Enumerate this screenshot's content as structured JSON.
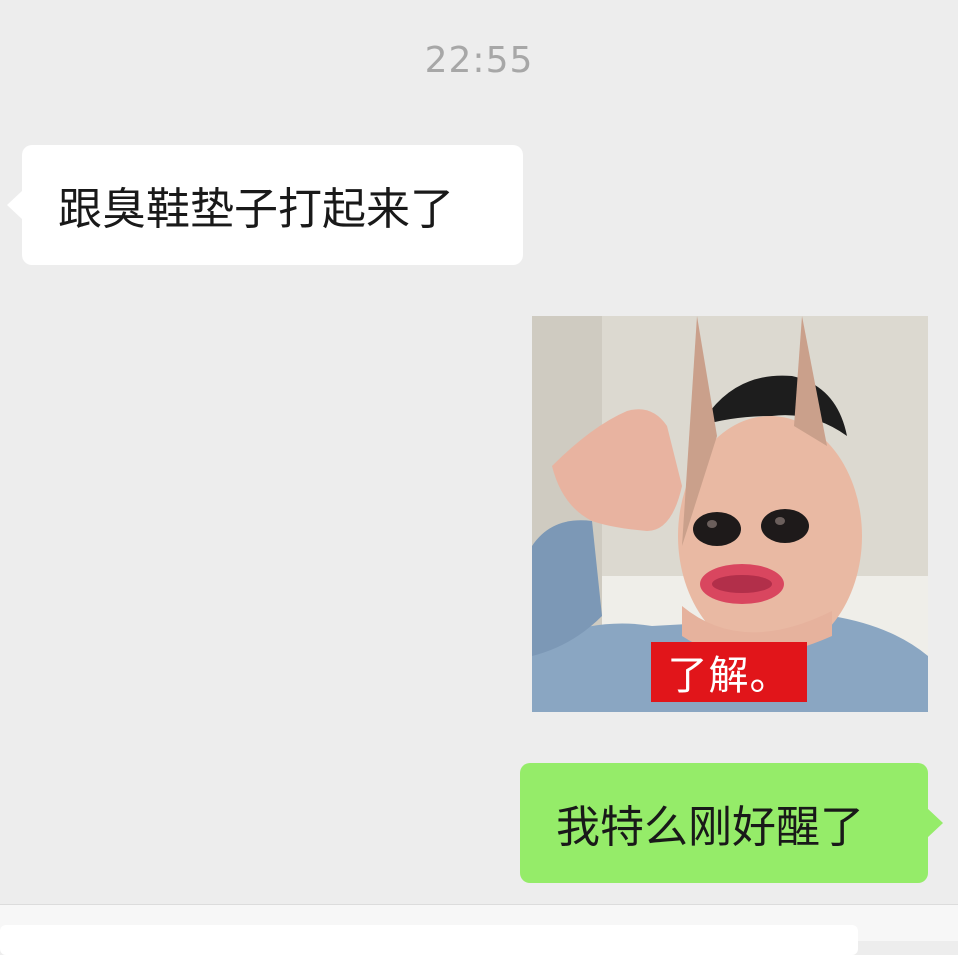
{
  "chat": {
    "timestamp": "22:55",
    "messages": [
      {
        "side": "left",
        "type": "text",
        "text": "跟臭鞋垫子打起来了"
      },
      {
        "side": "right",
        "type": "sticker",
        "caption": "了解。",
        "icon": "meme-sticker-image"
      },
      {
        "side": "right",
        "type": "text",
        "text": "我特么刚好醒了"
      }
    ]
  },
  "colors": {
    "background": "#ededed",
    "incoming_bubble": "#ffffff",
    "outgoing_bubble": "#95ec69",
    "timestamp": "#a7a7a7",
    "caption_bg": "#e1151a"
  }
}
